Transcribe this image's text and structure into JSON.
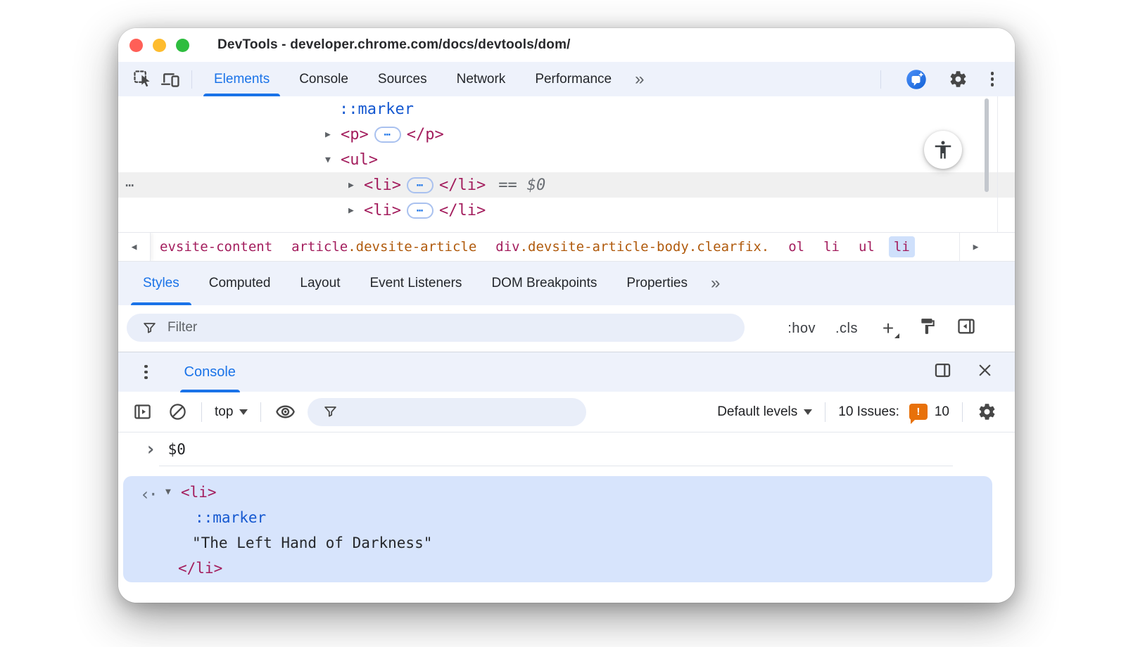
{
  "titlebar": {
    "title": "DevTools - developer.chrome.com/docs/devtools/dom/"
  },
  "main_toolbar": {
    "tabs": [
      "Elements",
      "Console",
      "Sources",
      "Network",
      "Performance"
    ],
    "overflow": "»"
  },
  "dom_tree": {
    "marker": "::marker",
    "p_open": "<p>",
    "p_close": "</p>",
    "ul_open": "<ul>",
    "li_open": "<li>",
    "li_close": "</li>",
    "eq": "==",
    "eq_value": "$0",
    "ellipsis": "⋯",
    "hover_dots": "⋯"
  },
  "breadcrumb": {
    "items": [
      {
        "el": "evsite-content",
        "cls": ""
      },
      {
        "el": "article",
        "cls": ".devsite-article"
      },
      {
        "el": "div",
        "cls": ".devsite-article-body.clearfix."
      },
      {
        "el": "ol",
        "cls": ""
      },
      {
        "el": "li",
        "cls": ""
      },
      {
        "el": "ul",
        "cls": ""
      },
      {
        "el": "li",
        "cls": ""
      }
    ]
  },
  "styles_panel": {
    "tabs": [
      "Styles",
      "Computed",
      "Layout",
      "Event Listeners",
      "DOM Breakpoints",
      "Properties"
    ],
    "overflow": "»",
    "filter_placeholder": "Filter",
    "hov": ":hov",
    "cls": ".cls",
    "plus": "+"
  },
  "drawer": {
    "tab": "Console"
  },
  "console_toolbar": {
    "context": "top",
    "levels": "Default levels",
    "issues_label": "10 Issues:",
    "issues_count": "10",
    "issue_glyph": "!"
  },
  "console": {
    "prompt_chevron": "›",
    "prompt_expression": "$0",
    "result": {
      "return_glyph": "‹·",
      "tag_open": "<li>",
      "marker": "::marker",
      "string": "\"The Left Hand of Darkness\"",
      "tag_close": "</li>"
    }
  },
  "glyphs": {
    "disclosure_open": "▼",
    "disclosure_closed": "▶",
    "crumb_left": "◀",
    "crumb_right": "▶"
  },
  "colors": {
    "accent_blue": "#1a73e8",
    "code_tag": "#a31d5d",
    "code_class": "#b05a0c",
    "code_pseudo": "#1558d0",
    "issues_orange": "#e8710a",
    "selection_bg": "#d7e4fc",
    "toolbar_bg": "#eef2fb"
  }
}
